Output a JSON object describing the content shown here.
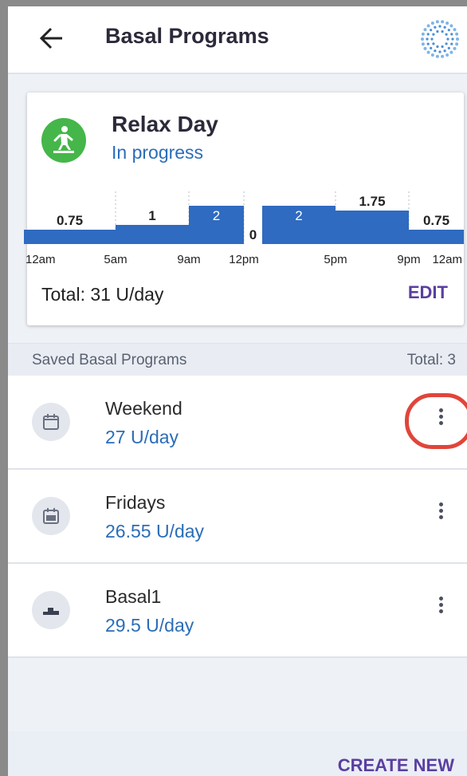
{
  "header": {
    "title": "Basal Programs",
    "back_icon": "arrow-left-icon",
    "status_icon": "pod-status-icon"
  },
  "active_program": {
    "name": "Relax Day",
    "status": "In progress",
    "icon": "person-relaxing-icon",
    "total": "Total: 31 U/day",
    "edit_label": "EDIT",
    "accent": "#45b649"
  },
  "chart_data": {
    "type": "bar",
    "segments": [
      {
        "start": 0,
        "end": 5,
        "value": 0.75,
        "label": "0.75"
      },
      {
        "start": 5,
        "end": 9,
        "value": 1,
        "label": "1"
      },
      {
        "start": 9,
        "end": 12,
        "value": 2,
        "label": "2"
      },
      {
        "start": 12,
        "end": 13,
        "value": 0,
        "label": "0"
      },
      {
        "start": 13,
        "end": 17,
        "value": 2,
        "label": "2"
      },
      {
        "start": 17,
        "end": 21,
        "value": 1.75,
        "label": "1.75"
      },
      {
        "start": 21,
        "end": 24,
        "value": 0.75,
        "label": "0.75"
      }
    ],
    "ticks": [
      {
        "hour": 0,
        "label": "12am"
      },
      {
        "hour": 5,
        "label": "5am"
      },
      {
        "hour": 9,
        "label": "9am"
      },
      {
        "hour": 12,
        "label": "12pm"
      },
      {
        "hour": 17,
        "label": "5pm"
      },
      {
        "hour": 21,
        "label": "9pm"
      },
      {
        "hour": 24,
        "label": "12am"
      }
    ],
    "xlim": [
      0,
      24
    ],
    "ylim": [
      0,
      2
    ],
    "bar_color": "#2f6bc0"
  },
  "saved": {
    "label": "Saved Basal Programs",
    "total": "Total: 3",
    "items": [
      {
        "name": "Weekend",
        "value": "27 U/day",
        "icon": "calendar-icon"
      },
      {
        "name": "Fridays",
        "value": "26.55 U/day",
        "icon": "calendar-grid-icon"
      },
      {
        "name": "Basal1",
        "value": "29.5 U/day",
        "icon": "basal-steps-icon"
      }
    ]
  },
  "create_label": "CREATE NEW",
  "colors": {
    "link": "#2a6db8",
    "action": "#5a3fa0",
    "highlight": "#e0453a"
  }
}
